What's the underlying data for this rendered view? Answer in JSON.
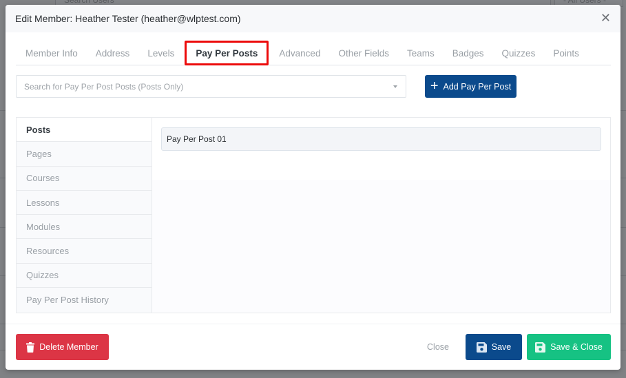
{
  "background": {
    "search_placeholder": "Search Users",
    "filter_select": "- All Users -"
  },
  "modal": {
    "title": "Edit Member: Heather Tester (heather@wlptest.com)",
    "close_icon": "close-icon"
  },
  "tabs": [
    {
      "label": "Member Info",
      "active": false
    },
    {
      "label": "Address",
      "active": false
    },
    {
      "label": "Levels",
      "active": false
    },
    {
      "label": "Pay Per Posts",
      "active": true
    },
    {
      "label": "Advanced",
      "active": false
    },
    {
      "label": "Other Fields",
      "active": false
    },
    {
      "label": "Teams",
      "active": false
    },
    {
      "label": "Badges",
      "active": false
    },
    {
      "label": "Quizzes",
      "active": false
    },
    {
      "label": "Points",
      "active": false
    }
  ],
  "search": {
    "placeholder": "Search for Pay Per Post Posts (Posts Only)",
    "value": ""
  },
  "add_button": {
    "label": "Add Pay Per Post",
    "icon": "plus-icon"
  },
  "side_nav": [
    {
      "label": "Posts",
      "active": true
    },
    {
      "label": "Pages",
      "active": false
    },
    {
      "label": "Courses",
      "active": false
    },
    {
      "label": "Lessons",
      "active": false
    },
    {
      "label": "Modules",
      "active": false
    },
    {
      "label": "Resources",
      "active": false
    },
    {
      "label": "Quizzes",
      "active": false
    },
    {
      "label": "Pay Per Post History",
      "active": false
    }
  ],
  "posts": [
    {
      "title": "Pay Per Post 01"
    }
  ],
  "footer": {
    "delete_label": "Delete Member",
    "close_label": "Close",
    "save_label": "Save",
    "save_close_label": "Save & Close"
  },
  "colors": {
    "primary": "#0b4a8c",
    "danger": "#dc3545",
    "success": "#16c283",
    "highlight": "#ec0b0b"
  }
}
